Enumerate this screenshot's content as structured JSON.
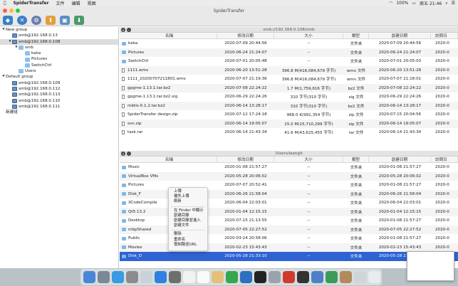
{
  "menubar": {
    "app": "SpiderTransfer",
    "items": [
      "文件",
      "编辑",
      "视图"
    ],
    "status": {
      "battery": "100%",
      "time": "周五 21:46"
    }
  },
  "window": {
    "title": "SpiderTransfer"
  },
  "toolbar": {
    "icons": [
      "connect-icon",
      "close-icon",
      "settings-icon",
      "upload-icon",
      "monitor-icon",
      "download-icon"
    ]
  },
  "sidebar": {
    "rows": [
      {
        "label": "New group",
        "indent": 0,
        "kind": "group",
        "open": true
      },
      {
        "label": "smb@192.168.0.13",
        "indent": 1,
        "kind": "pc"
      },
      {
        "label": "smb@192.168.0.108",
        "indent": 1,
        "kind": "pc",
        "open": true,
        "selected": true
      },
      {
        "label": "smb",
        "indent": 2,
        "kind": "folder",
        "open": true
      },
      {
        "label": "kaka",
        "indent": 3,
        "kind": "folder"
      },
      {
        "label": "Pictures",
        "indent": 3,
        "kind": "folder"
      },
      {
        "label": "SwitchCtrl",
        "indent": 3,
        "kind": "folder"
      },
      {
        "label": "Users",
        "indent": 2,
        "kind": "folder"
      },
      {
        "label": "Default group",
        "indent": 0,
        "kind": "group",
        "open": true
      },
      {
        "label": "smb@192.168.0.109",
        "indent": 1,
        "kind": "pc"
      },
      {
        "label": "smb@192.168.0.112",
        "indent": 1,
        "kind": "pc"
      },
      {
        "label": "smb@192.168.0.113",
        "indent": 1,
        "kind": "pc"
      },
      {
        "label": "smb@192.168.0.110",
        "indent": 1,
        "kind": "pc"
      },
      {
        "label": "smb@192.168.0.111",
        "indent": 1,
        "kind": "pc"
      },
      {
        "label": "新建组",
        "indent": 0,
        "kind": "text"
      }
    ]
  },
  "columns": [
    "名稱",
    "修改日期",
    "大小",
    "類型",
    "創建日期",
    "訪問日"
  ],
  "top_pane": {
    "path": "smb://192.168.0.108/smb",
    "rows": [
      {
        "name": "kaka",
        "date": "2020-07-09 20:44:56",
        "size": "--",
        "type": "文件夹",
        "created": "2020-07-09 20:44:56",
        "acc": "2020-0",
        "icon": "folder"
      },
      {
        "name": "Pictures",
        "date": "2020-06-24 21:24:07",
        "size": "--",
        "type": "文件夹",
        "created": "2020-06-24 21:24:07",
        "acc": "2020-0",
        "icon": "folder"
      },
      {
        "name": "SwitchCtrl",
        "date": "2020-07-01 20:05:48",
        "size": "--",
        "type": "文件夹",
        "created": "2020-07-01 20:05:03",
        "acc": "2020-0",
        "icon": "folder"
      },
      {
        "name": "1111.wmv",
        "date": "2020-06-20 13:51:28",
        "size": "396.8 M(416,084,679 字节)",
        "type": "wmv 文件",
        "created": "2020-06-20 13:51:28",
        "acc": "2020-0",
        "icon": "doc"
      },
      {
        "name": "1111_20200707211801.wmv",
        "date": "2020-07-07 21:19:36",
        "size": "396.8 M(416,084,679 字节)",
        "type": "wmv 文件",
        "created": "2020-07-07 21:18:01",
        "acc": "2020-0",
        "icon": "doc"
      },
      {
        "name": "gpgme-1.13.1.tar.bz2",
        "date": "2020-07-08 22:24:22",
        "size": "1.7 M(1,759,616 字节)",
        "type": "bz2 文件",
        "created": "2020-07-08 22:24:22",
        "acc": "2020-0",
        "icon": "doc"
      },
      {
        "name": "gpgme-1.13.1.tar.bz2.sig",
        "date": "2020-06-29 22:24:26",
        "size": "310 字节(310 字节)",
        "type": "sig 文件",
        "created": "2020-06-29 22:24:26",
        "acc": "2020-0",
        "icon": "doc"
      },
      {
        "name": "mbtls-0.1.2.tar.bz2",
        "date": "2020-06-14 13:28:17",
        "size": "310 字节(310 字节)",
        "type": "bz2 文件",
        "created": "2020-06-14 13:28:17",
        "acc": "2020-0",
        "icon": "doc"
      },
      {
        "name": "SpiderTransfer design.zip",
        "date": "2020-07-12 17:24:18",
        "size": "968.0 K(991,354 字节)",
        "type": "zip 文件",
        "created": "2020-07-15 20:04:56",
        "acc": "2020-0",
        "icon": "doc"
      },
      {
        "name": "svn.zip",
        "date": "2020-06-14 19:05:07",
        "size": "15.0 M(15,710,299 字节)",
        "type": "zip 文件",
        "created": "2020-06-14 19:05:07",
        "acc": "2020-0",
        "icon": "doc"
      },
      {
        "name": "task.rar",
        "date": "2020-06-14 21:43:34",
        "size": "41.6 M(43,625,455 字节)",
        "type": "rar 文件",
        "created": "2020-06-14 21:43:34",
        "acc": "2020-0",
        "icon": "doc"
      }
    ]
  },
  "bottom_pane": {
    "path": "/Users/wanglt",
    "rows": [
      {
        "name": "Music",
        "date": "2020-01-08 21:57:27",
        "size": "--",
        "type": "文件夹",
        "created": "2020-01-08 21:57:27",
        "acc": "2020-0",
        "icon": "folder"
      },
      {
        "name": "VirtualBox VMs",
        "date": "2020-05-28 20:06:02",
        "size": "--",
        "type": "文件夹",
        "created": "2020-05-28 20:06:02",
        "acc": "2020-0",
        "icon": "folder"
      },
      {
        "name": "Pictures",
        "date": "2020-07-07 20:52:41",
        "size": "--",
        "type": "文件夹",
        "created": "2020-01-08 21:57:27",
        "acc": "2020-0",
        "icon": "folder"
      },
      {
        "name": "Disk_F",
        "date": "2020-06-26 21:58:04",
        "size": "--",
        "type": "文件夹",
        "created": "2020-06-26 21:58:04",
        "acc": "2020-0",
        "icon": "folder"
      },
      {
        "name": "XCodeCompile",
        "date": "2020-06-04 22:03:01",
        "size": "--",
        "type": "文件夹",
        "created": "2020-06-04 22:03:01",
        "acc": "2020-0",
        "icon": "folder"
      },
      {
        "name": "Qt5.13.2",
        "date": "2020-01-04 12:15:15",
        "size": "--",
        "type": "文件夹",
        "created": "2020-01-04 12:15:15",
        "acc": "2020-0",
        "icon": "folder"
      },
      {
        "name": "Desktop",
        "date": "2020-07-15 21:13:55",
        "size": "--",
        "type": "文件夹",
        "created": "2020-01-08 21:57:27",
        "acc": "2020-0",
        "icon": "folder"
      },
      {
        "name": "mbpShared",
        "date": "2020-07-05 22:27:52",
        "size": "--",
        "type": "文件夹",
        "created": "2020-07-05 22:27:52",
        "acc": "2020-0",
        "icon": "folder"
      },
      {
        "name": "Public",
        "date": "2020-03-24 20:58:06",
        "size": "--",
        "type": "文件夹",
        "created": "2020-01-08 21:57:27",
        "acc": "2020-0",
        "icon": "folder"
      },
      {
        "name": "Movies",
        "date": "2020-02-23 15:43:43",
        "size": "--",
        "type": "文件夹",
        "created": "2020-02-23 15:43:43",
        "acc": "2020-0",
        "icon": "folder"
      },
      {
        "name": "Disk_D",
        "date": "2020-05-28 21:33:10",
        "size": "--",
        "type": "文件夹",
        "created": "2020-05-28 21:33:10",
        "acc": "2020-0",
        "icon": "folder",
        "selected": true
      }
    ]
  },
  "context_menu": {
    "groups": [
      [
        "上傳",
        "優先上傳",
        "刷新"
      ],
      [
        "在 Finder 中顯示",
        "創建目錄",
        "創建目錄並進入",
        "創建文件"
      ],
      [
        "刪除",
        "重命名",
        "復制路徑URL"
      ]
    ]
  }
}
